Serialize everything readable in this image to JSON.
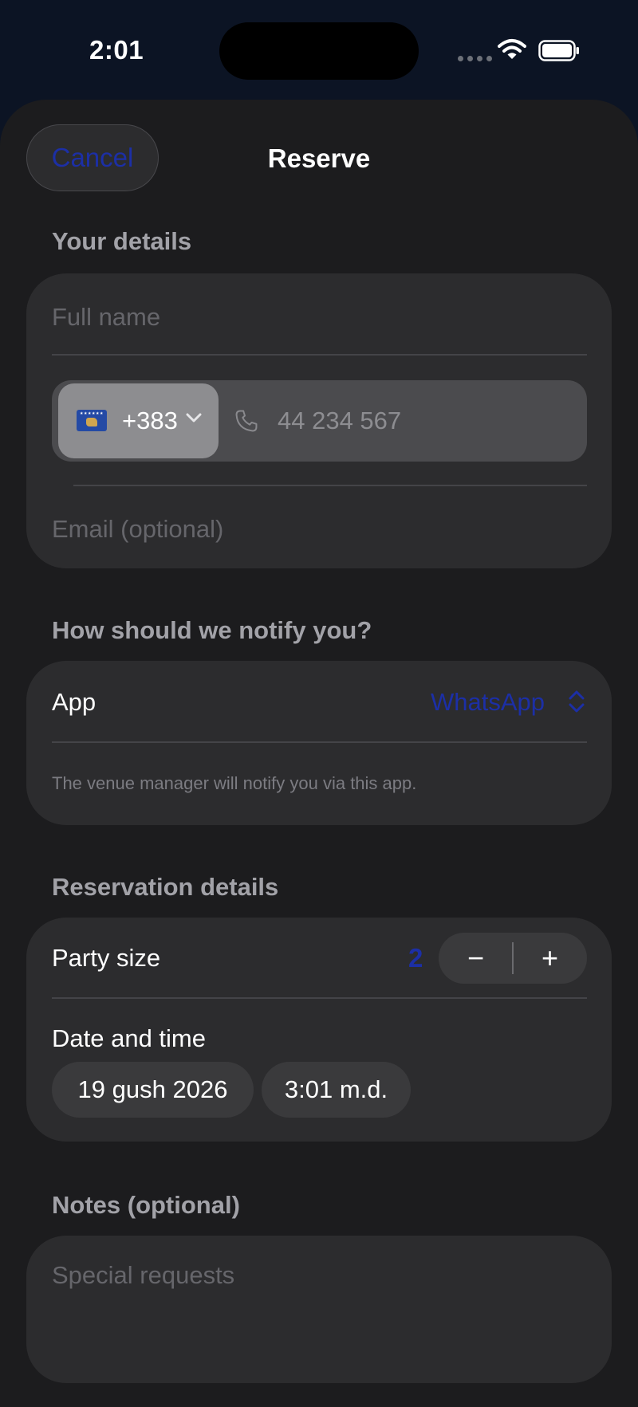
{
  "status_bar": {
    "time": "2:01"
  },
  "header": {
    "cancel_label": "Cancel",
    "title": "Reserve"
  },
  "your_details": {
    "section_title": "Your details",
    "full_name_placeholder": "Full name",
    "phone": {
      "country_flag": "kosovo-flag",
      "country_code": "+383",
      "placeholder": "44 234 567"
    },
    "email_placeholder": "Email (optional)"
  },
  "notify": {
    "section_title": "How should we notify you?",
    "app_label": "App",
    "app_value": "WhatsApp",
    "helper_text": "The venue manager will notify you via this app."
  },
  "reservation": {
    "section_title": "Reservation details",
    "party_size_label": "Party size",
    "party_size_value": "2",
    "decrement_symbol": "−",
    "increment_symbol": "+",
    "date_time_label": "Date and time",
    "date_value": "19 gush 2026",
    "time_value": "3:01 m.d."
  },
  "notes": {
    "section_title": "Notes (optional)",
    "placeholder": "Special requests"
  },
  "colors": {
    "accent": "#1c2fa6",
    "sheet_bg": "#1c1c1e",
    "card_bg": "#2c2c2e",
    "backdrop": "#0c1424"
  }
}
